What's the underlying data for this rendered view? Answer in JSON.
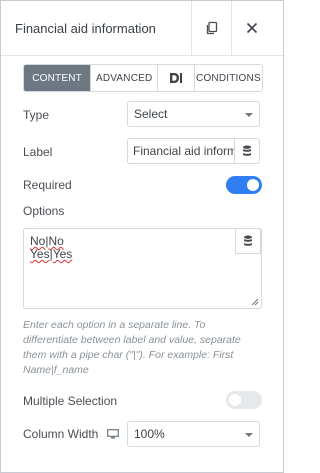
{
  "header": {
    "title": "Financial aid information"
  },
  "tabs": [
    {
      "label": "CONTENT",
      "active": true
    },
    {
      "label": "ADVANCED",
      "active": false
    },
    {
      "label": "",
      "icon": "dynamic-tags-icon",
      "active": false
    },
    {
      "label": "CONDITIONS",
      "active": false
    }
  ],
  "fields": {
    "type": {
      "label": "Type",
      "value": "Select"
    },
    "label": {
      "label": "Label",
      "value": "Financial aid information"
    },
    "required": {
      "label": "Required",
      "on": true
    },
    "options": {
      "label": "Options",
      "lines": [
        {
          "a": "No",
          "sep": "|",
          "b": "No"
        },
        {
          "a": "Yes",
          "sep": "|",
          "b": "Yes"
        }
      ],
      "help": "Enter each option in a separate line. To differentiate between label and value, separate them with a pipe char (\"|\"). For example: First Name|f_name"
    },
    "multiple": {
      "label": "Multiple Selection",
      "on": false
    },
    "column_width": {
      "label": "Column Width",
      "value": "100%",
      "device_icon": "desktop-icon"
    }
  },
  "colors": {
    "toggle_on": "#2f7ef3",
    "tab_active": "#6d7882"
  }
}
